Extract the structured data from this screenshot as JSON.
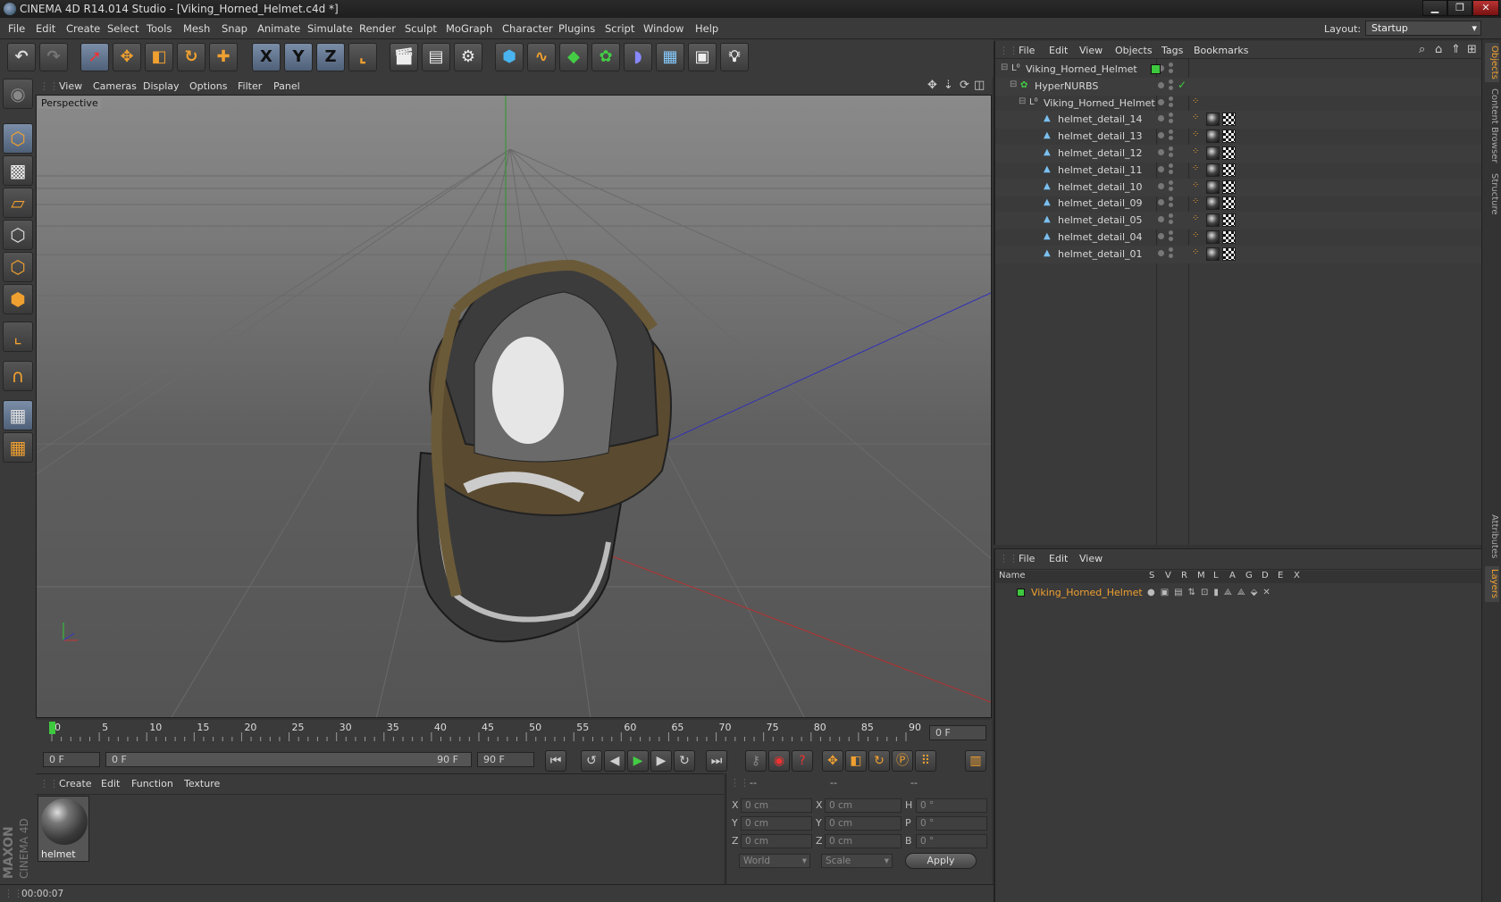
{
  "window": {
    "title": "CINEMA 4D R14.014 Studio - [Viking_Horned_Helmet.c4d *]",
    "controls": [
      "▁",
      "❐",
      "✕"
    ]
  },
  "menu": [
    "File",
    "Edit",
    "Create",
    "Select",
    "Tools",
    "Mesh",
    "Snap",
    "Animate",
    "Simulate",
    "Render",
    "Sculpt",
    "MoGraph",
    "Character",
    "Plugins",
    "Script",
    "Window",
    "Help"
  ],
  "layout": {
    "label": "Layout:",
    "value": "Startup"
  },
  "toolbar": {
    "x_label": "X",
    "y_label": "Y",
    "z_label": "Z"
  },
  "viewport": {
    "menu": [
      "View",
      "Cameras",
      "Display",
      "Options",
      "Filter",
      "Panel"
    ],
    "label": "Perspective"
  },
  "timeline": {
    "ticks": [
      "0",
      "5",
      "10",
      "15",
      "20",
      "25",
      "30",
      "35",
      "40",
      "45",
      "50",
      "55",
      "60",
      "65",
      "70",
      "75",
      "80",
      "85",
      "90"
    ],
    "current_frame": "0 F"
  },
  "playback": {
    "start": "0 F",
    "range_start": "0 F",
    "range_end": "90 F",
    "end": "90 F"
  },
  "material_manager": {
    "menu": [
      "Create",
      "Edit",
      "Function",
      "Texture"
    ],
    "materials": [
      {
        "name": "helmet"
      }
    ]
  },
  "coords": {
    "headers": [
      "--",
      "--",
      "--"
    ],
    "rows": [
      {
        "a": "X",
        "av": "0 cm",
        "b": "X",
        "bv": "0 cm",
        "c": "H",
        "cv": "0 °"
      },
      {
        "a": "Y",
        "av": "0 cm",
        "b": "Y",
        "bv": "0 cm",
        "c": "P",
        "cv": "0 °"
      },
      {
        "a": "Z",
        "av": "0 cm",
        "b": "Z",
        "bv": "0 cm",
        "c": "B",
        "cv": "0 °"
      }
    ],
    "mode": "World",
    "size_mode": "Scale",
    "apply": "Apply"
  },
  "status": {
    "time": "00:00:07",
    "brand1": "MAXON",
    "brand2": "CINEMA 4D"
  },
  "object_manager": {
    "menu": [
      "File",
      "Edit",
      "View",
      "Objects",
      "Tags",
      "Bookmarks"
    ],
    "objects": [
      {
        "name": "Viking_Horned_Helmet",
        "type": "null-icon"
      },
      {
        "name": "HyperNURBS",
        "type": "hypernurbs-icon"
      },
      {
        "name": "Viking_Horned_Helmet",
        "type": "null-icon"
      },
      {
        "name": "helmet_detail_14",
        "type": "polygon-icon"
      },
      {
        "name": "helmet_detail_13",
        "type": "polygon-icon"
      },
      {
        "name": "helmet_detail_12",
        "type": "polygon-icon"
      },
      {
        "name": "helmet_detail_11",
        "type": "polygon-icon"
      },
      {
        "name": "helmet_detail_10",
        "type": "polygon-icon"
      },
      {
        "name": "helmet_detail_09",
        "type": "polygon-icon"
      },
      {
        "name": "helmet_detail_05",
        "type": "polygon-icon"
      },
      {
        "name": "helmet_detail_04",
        "type": "polygon-icon"
      },
      {
        "name": "helmet_detail_01",
        "type": "polygon-icon"
      }
    ]
  },
  "layer_manager": {
    "menu": [
      "File",
      "Edit",
      "View"
    ],
    "columns": [
      "Name",
      "S",
      "V",
      "R",
      "M",
      "L",
      "A",
      "G",
      "D",
      "E",
      "X"
    ],
    "layers": [
      {
        "name": "Viking_Horned_Helmet",
        "color": "#3ec83e"
      }
    ]
  },
  "side_tabs": [
    "Objects",
    "Content Browser",
    "Structure",
    "Attributes",
    "Layers"
  ],
  "colors": {
    "accent": "#f0a030",
    "layer_text": "#f0a030",
    "selected_blue": "#4f6078"
  }
}
